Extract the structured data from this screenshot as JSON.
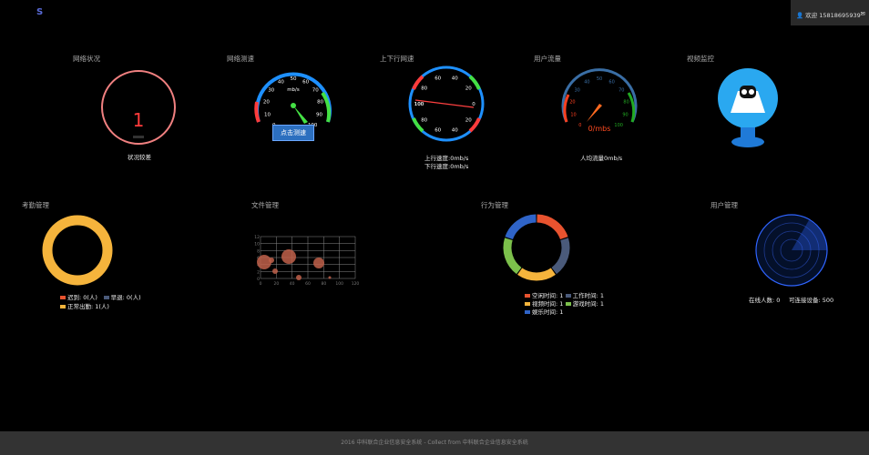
{
  "header": {
    "logo": "S",
    "user_text": "欢迎 15818695939",
    "mail_icon": "mail-icon"
  },
  "panels": {
    "network_status": {
      "title": "网络状况",
      "value": "1",
      "caption": "状况较差"
    },
    "network_speed": {
      "title": "网络测速",
      "unit": "mb/s",
      "ticks": [
        "0",
        "10",
        "20",
        "30",
        "40",
        "50",
        "60",
        "70",
        "80",
        "90",
        "100"
      ],
      "button": "点击测速"
    },
    "updown_speed": {
      "title": "上下行网速",
      "ticks": [
        "100",
        "80",
        "60",
        "40",
        "20",
        "0",
        "20",
        "40",
        "60",
        "80",
        "100"
      ],
      "up": "上行速度:0mb/s",
      "down": "下行速度:0mb/s"
    },
    "user_traffic": {
      "title": "用户流量",
      "ticks": [
        "0",
        "10",
        "20",
        "30",
        "40",
        "50",
        "60",
        "70",
        "80",
        "90",
        "100"
      ],
      "unit_label": "0/mbs",
      "caption": "人均流量0mb/s"
    },
    "video_monitor": {
      "title": "视频监控"
    },
    "attendance": {
      "title": "考勤管理",
      "legend": [
        {
          "label": "迟到: 0(人)",
          "color": "#e8532f"
        },
        {
          "label": "早退: 0(人)",
          "color": "#4a5a7a"
        },
        {
          "label": "正常出勤: 1(人)",
          "color": "#f5b43c"
        }
      ]
    },
    "file_mgmt": {
      "title": "文件管理",
      "y_ticks": [
        "12",
        "10",
        "8",
        "6",
        "4",
        "2",
        "0"
      ],
      "x_ticks": [
        "0",
        "20",
        "40",
        "60",
        "80",
        "100",
        "120"
      ]
    },
    "behavior": {
      "title": "行为管理",
      "legend": [
        {
          "label": "空闲时间: 1",
          "color": "#e8532f"
        },
        {
          "label": "工作时间: 1",
          "color": "#4a5a7a"
        },
        {
          "label": "视频时间: 1",
          "color": "#f5b43c"
        },
        {
          "label": "游戏时间: 1",
          "color": "#7cc04b"
        },
        {
          "label": "娱乐时间: 1",
          "color": "#2f64c8"
        }
      ]
    },
    "user_mgmt": {
      "title": "用户管理",
      "online": "在线人数: 0",
      "devices": "可连接设备: 500"
    }
  },
  "footer": {
    "text": "2016 中科联合企业信息安全系统 - Collect from 中科联合企业信息安全系统"
  }
}
